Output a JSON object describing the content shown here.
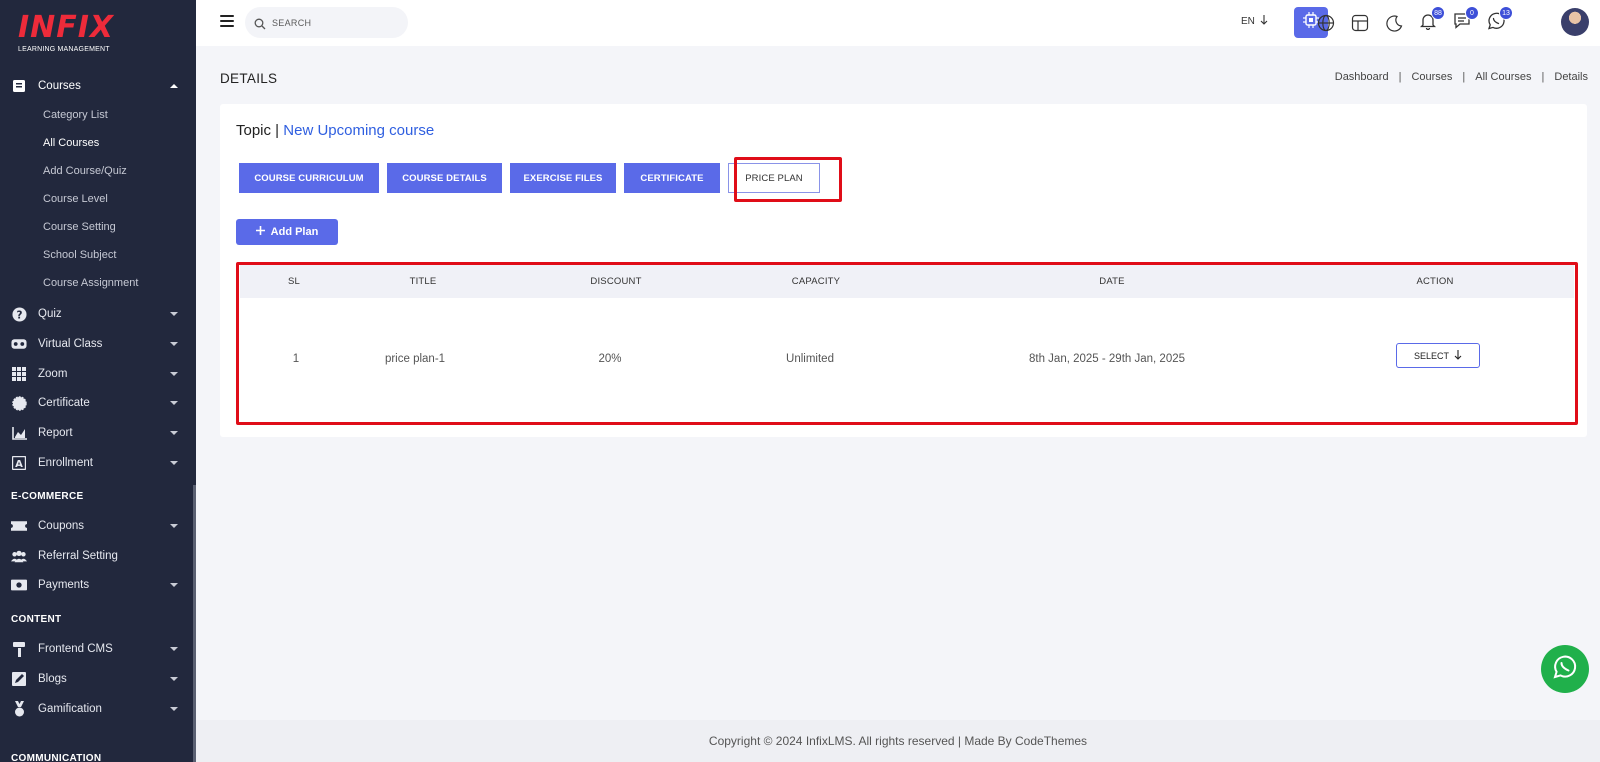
{
  "brand": {
    "logo_text": "INFIX",
    "logo_sub": "LEARNING MANAGEMENT"
  },
  "sidebar": {
    "courses_label": "Courses",
    "submenu": [
      "Category List",
      "All Courses",
      "Add Course/Quiz",
      "Course Level",
      "Course Setting",
      "School Subject",
      "Course Assignment"
    ],
    "items": [
      {
        "label": "Quiz",
        "icon": "question-circle-icon"
      },
      {
        "label": "Virtual Class",
        "icon": "vr-headset-icon"
      },
      {
        "label": "Zoom",
        "icon": "grid-icon"
      },
      {
        "label": "Certificate",
        "icon": "certificate-icon"
      },
      {
        "label": "Report",
        "icon": "chart-icon"
      },
      {
        "label": "Enrollment",
        "icon": "enrollment-icon"
      }
    ],
    "section_ecommerce": "E-COMMERCE",
    "ecommerce_items": [
      {
        "label": "Coupons",
        "icon": "ticket-icon"
      },
      {
        "label": "Referral Setting",
        "icon": "users-icon"
      },
      {
        "label": "Payments",
        "icon": "money-icon"
      }
    ],
    "section_content": "CONTENT",
    "content_items": [
      {
        "label": "Frontend CMS",
        "icon": "paint-roller-icon"
      },
      {
        "label": "Blogs",
        "icon": "edit-icon"
      },
      {
        "label": "Gamification",
        "icon": "medal-icon"
      }
    ],
    "section_communication": "COMMUNICATION"
  },
  "topbar": {
    "search_placeholder": "SEARCH",
    "lang": "EN",
    "notifications_count": "88",
    "messages_count": "0",
    "whatsapp_count": "13"
  },
  "page": {
    "title": "DETAILS",
    "breadcrumb": [
      "Dashboard",
      "Courses",
      "All Courses",
      "Details"
    ],
    "topic_prefix": "Topic |",
    "course_name": "New Upcoming course"
  },
  "tabs": [
    "COURSE CURRICULUM",
    "COURSE DETAILS",
    "EXERCISE FILES",
    "CERTIFICATE",
    "PRICE PLAN"
  ],
  "add_plan_label": "Add Plan",
  "table": {
    "headers": [
      "SL",
      "TITLE",
      "DISCOUNT",
      "CAPACITY",
      "DATE",
      "ACTION"
    ],
    "rows": [
      {
        "sl": "1",
        "title": "price plan-1",
        "discount": "20%",
        "capacity": "Unlimited",
        "date": "8th Jan, 2025 - 29th Jan, 2025",
        "action": "SELECT"
      }
    ]
  },
  "footer": "Copyright © 2024 InfixLMS. All rights reserved | Made By CodeThemes",
  "colors": {
    "accent": "#5a6ae8",
    "sidebar": "#22283d",
    "highlight": "#e00d18",
    "link": "#2f5fe0",
    "whatsapp": "#20b04b"
  }
}
